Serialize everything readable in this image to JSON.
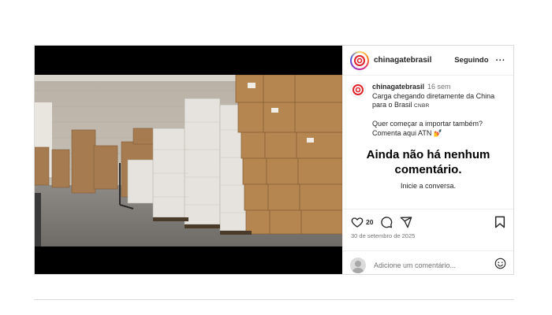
{
  "profile": {
    "username": "chinagatebrasil",
    "follow_status": "Seguindo",
    "more_label": "···"
  },
  "caption": {
    "username": "chinagatebrasil",
    "time": "16 sem",
    "line1": "Carga chegando diretamente da China",
    "line2_text": "para o Brasil",
    "line2_tag": "CNBR",
    "line3": "Quer começar a importar também?",
    "line4": "Comenta aqui ATN",
    "line4_emoji": "💅"
  },
  "comments_empty": {
    "title_line1": "Ainda não há nenhum",
    "title_line2": "comentário.",
    "subtitle": "Inicie a conversa."
  },
  "actions": {
    "like_count": "20",
    "date": "30 de setembro de 2025"
  },
  "comment_box": {
    "placeholder": "Adicione um comentário..."
  },
  "icons": {
    "like": "heart-icon",
    "comment": "comment-icon",
    "share": "share-icon",
    "save": "bookmark-icon",
    "emoji": "emoji-icon"
  },
  "colors": {
    "border": "#dbdbdb",
    "secondary_text": "#737373",
    "brand_red": "#e0242b"
  }
}
